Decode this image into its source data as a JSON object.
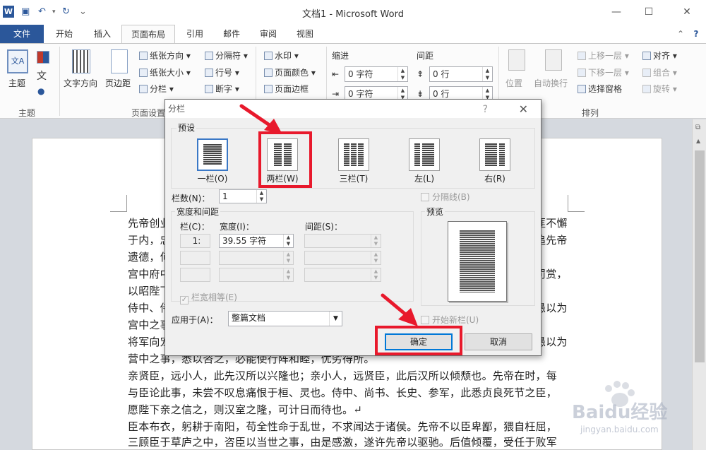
{
  "window": {
    "title": "文档1 - Microsoft Word",
    "app_icon": "W",
    "quick_access": [
      "save-icon",
      "undo-icon",
      "redo-icon",
      "customize-icon"
    ],
    "controls": [
      "minimize-icon",
      "restore-icon",
      "close-icon"
    ]
  },
  "tabs": [
    {
      "label": "文件",
      "state": "file"
    },
    {
      "label": "开始"
    },
    {
      "label": "插入"
    },
    {
      "label": "页面布局",
      "state": "active"
    },
    {
      "label": "引用"
    },
    {
      "label": "邮件"
    },
    {
      "label": "审阅"
    },
    {
      "label": "视图"
    }
  ],
  "ribbon": {
    "theme_group": {
      "big_button": "主题",
      "group_label": "主题",
      "small": [
        "文",
        "●"
      ]
    },
    "page_setup": {
      "text_direction": "文字方向",
      "margins": "页边距",
      "orientation": "纸张方向",
      "size": "纸张大小",
      "columns": "分栏",
      "breaks": "分隔符",
      "line_numbers": "行号",
      "hyphenation": "断字",
      "group_label": "页面设置"
    },
    "page_background": {
      "watermark": "水印",
      "page_color": "页面颜色",
      "page_borders": "页面边框"
    },
    "paragraph": {
      "indent_label": "缩进",
      "spacing_label": "间距",
      "indent_left": "0 字符",
      "indent_right": "0 字符",
      "spacing_before": "0 行",
      "spacing_after": "0 行"
    },
    "arrange": {
      "position": "位置",
      "wrap_text": "自动换行",
      "bring_forward": "上移一层",
      "send_backward": "下移一层",
      "selection_pane": "选择窗格",
      "align": "对齐",
      "group": "组合",
      "rotate": "旋转",
      "group_label": "排列"
    }
  },
  "document": {
    "lines": [
      "先帝创业",
      "于内，忠",
      "遗德，何",
      "宫中府中",
      "以昭陛下",
      "侍中、侍",
      "宫中之事",
      "将军向宠",
      "营中之事，悉以咨之，必能使行阵和睦，优劣得所。",
      "亲贤臣，远小人，此先汉所以兴隆也；亲小人，远贤臣，此后汉所以倾颓也。先帝在时，每",
      "与臣论此事，未尝不叹息痛恨于桓、灵也。侍中、尚书、长史、参军，此悉贞良死节之臣，",
      "愿陛下亲之信之，则汉室之隆，可计日而待也。↵",
      "臣本布衣，躬耕于南阳，苟全性命于乱世，不求闻达于诸侯。先帝不以臣卑鄙，猥自枉屈，",
      "三顾臣于草庐之中，咨臣以当世之事，由是感激，遂许先帝以驱驰。后值倾覆，受任于败军"
    ],
    "right_fragments": [
      "匪不懈",
      "追先帝",
      "",
      "罚赏，",
      "",
      "愚以为",
      "",
      "愚以为"
    ]
  },
  "dialog": {
    "title": "分栏",
    "help": "?",
    "close": "✕",
    "presets_label": "预设",
    "presets": [
      {
        "label": "一栏(O)",
        "cols": 1,
        "selected": true
      },
      {
        "label": "两栏(W)",
        "cols": 2
      },
      {
        "label": "三栏(T)",
        "cols": 3
      },
      {
        "label": "左(L)",
        "cols": "left"
      },
      {
        "label": "右(R)",
        "cols": "right"
      }
    ],
    "num_columns_label": "栏数(N)：",
    "num_columns_value": "1",
    "line_between_label": "分隔线(B)",
    "width_spacing_label": "宽度和间距",
    "col_header": "栏(C)：",
    "width_header": "宽度(I)：",
    "spacing_header": "间距(S)：",
    "row1_col": "1:",
    "row1_width": "39.55 字符",
    "equal_width_label": "栏宽相等(E)",
    "preview_label": "预览",
    "apply_to_label": "应用于(A)：",
    "apply_to_value": "整篇文档",
    "start_new_column_label": "开始新栏(U)",
    "ok": "确定",
    "cancel": "取消"
  },
  "watermark": {
    "brand": "Baidu经验",
    "url": "jingyan.baidu.com"
  },
  "colors": {
    "accent": "#2b579a",
    "highlight": "#e8192c",
    "dialog_bg": "#f0f0f0"
  }
}
